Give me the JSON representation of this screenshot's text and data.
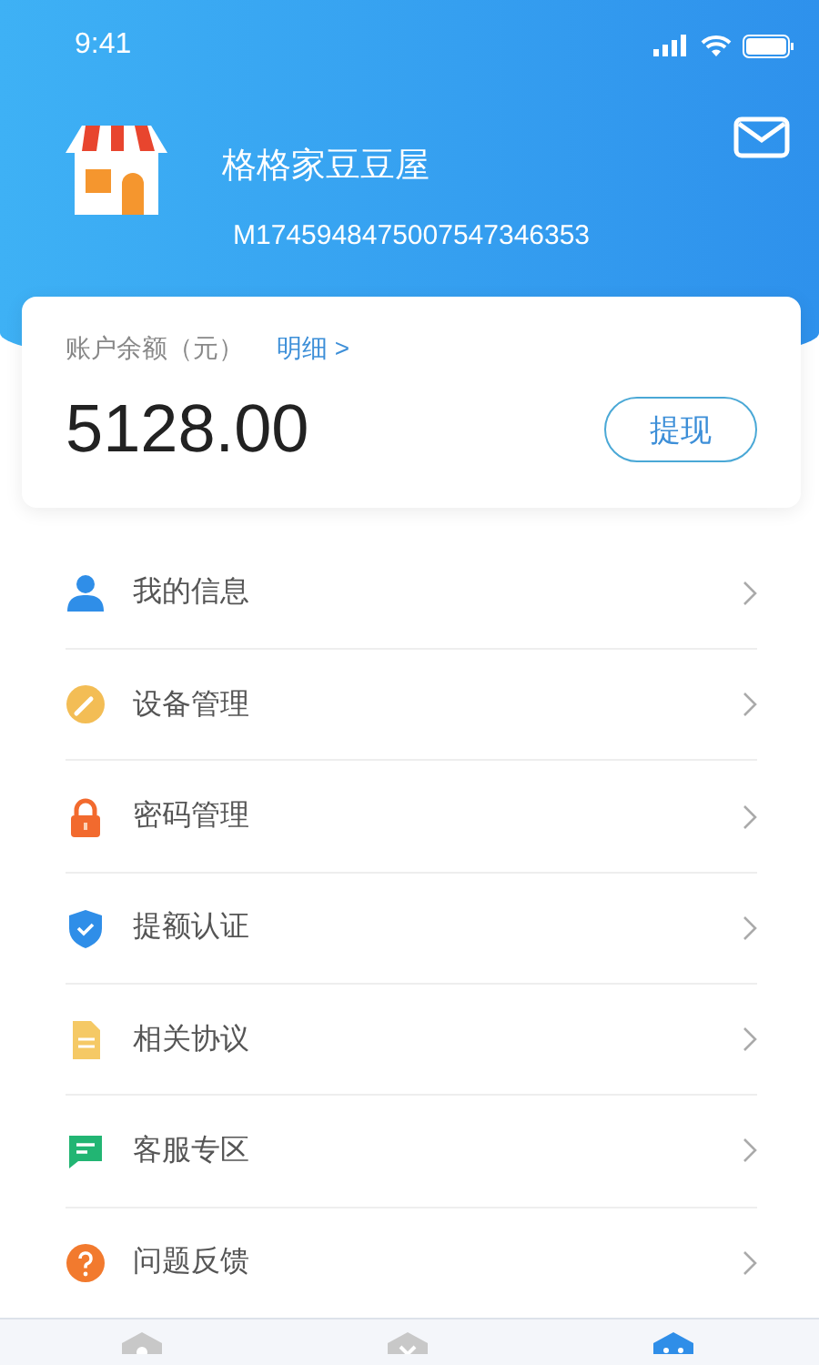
{
  "status_bar": {
    "time": "9:41"
  },
  "shop": {
    "name": "格格家豆豆屋",
    "id": "M1745948475007547346353"
  },
  "balance": {
    "label": "账户余额（元）",
    "detail_link": "明细 >",
    "amount": "5128.00",
    "withdraw_button": "提现"
  },
  "menu": [
    {
      "label": "我的信息"
    },
    {
      "label": "设备管理"
    },
    {
      "label": "密码管理"
    },
    {
      "label": "提额认证"
    },
    {
      "label": "相关协议"
    },
    {
      "label": "客服专区"
    },
    {
      "label": "问题反馈"
    }
  ],
  "tab_bar": [
    {
      "selected": false
    },
    {
      "selected": false
    },
    {
      "selected": true
    }
  ]
}
